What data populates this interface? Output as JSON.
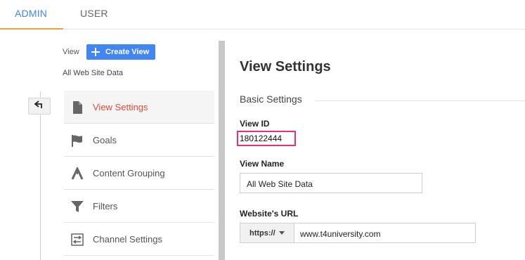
{
  "tabs": {
    "admin": "ADMIN",
    "user": "USER"
  },
  "view_selector": {
    "label": "View",
    "create_button": "Create View",
    "current_view": "All Web Site Data"
  },
  "nav": {
    "items": [
      {
        "label": "View Settings",
        "icon": "document-icon",
        "active": true
      },
      {
        "label": "Goals",
        "icon": "flag-icon"
      },
      {
        "label": "Content Grouping",
        "icon": "content-grouping-icon"
      },
      {
        "label": "Filters",
        "icon": "filter-icon"
      },
      {
        "label": "Channel Settings",
        "icon": "channel-settings-icon"
      }
    ]
  },
  "main": {
    "title": "View Settings",
    "section": "Basic Settings",
    "view_id_label": "View ID",
    "view_id_value": "180122444",
    "view_name_label": "View Name",
    "view_name_value": "All Web Site Data",
    "url_label": "Website's URL",
    "url_protocol": "https://",
    "url_value": "www.t4university.com"
  },
  "colors": {
    "accent_blue": "#4285f4",
    "active_red": "#dd4b39",
    "tab_underline": "#f2a03d",
    "highlight_pink": "#e8307a"
  }
}
